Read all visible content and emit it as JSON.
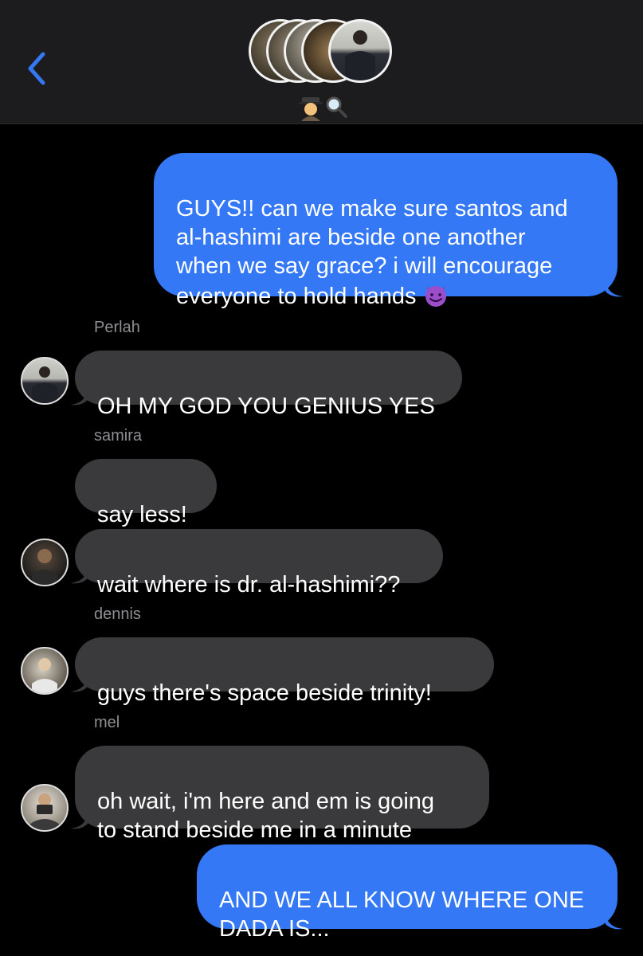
{
  "header": {
    "back_icon": "chevron-left-icon",
    "group_avatars": [
      "member-avatar",
      "member-avatar",
      "member-avatar",
      "member-avatar",
      "member-avatar"
    ],
    "group_name_icons": [
      "detective-emoji-icon",
      "magnifying-glass-icon"
    ],
    "background": "#1c1c1e",
    "accent": "#3478f6"
  },
  "messages": [
    {
      "direction": "outgoing",
      "text": "GUYS!! can we make sure santos and\nal-hashimi are beside one another\nwhen we say grace? i will encourage\neveryone to hold hands",
      "emoji_icon": "smiling-devil-icon"
    },
    {
      "direction": "incoming",
      "sender": "Perlah",
      "text": "OH MY GOD YOU GENIUS YES"
    },
    {
      "direction": "incoming",
      "sender": "samira",
      "text": "say less!"
    },
    {
      "direction": "incoming",
      "text": "wait where is dr. al-hashimi??"
    },
    {
      "direction": "incoming",
      "sender": "dennis",
      "text": "guys there's space beside trinity!"
    },
    {
      "direction": "incoming",
      "sender": "mel",
      "text": "oh wait, i'm here and em is going\nto stand beside me in a minute"
    },
    {
      "direction": "outgoing",
      "text": "AND WE ALL KNOW WHERE ONE\nDADA IS..."
    }
  ],
  "colors": {
    "outgoing_bubble": "#3478f6",
    "incoming_bubble": "#3a3a3c",
    "sender_label": "#8e8e93",
    "background": "#000000"
  }
}
